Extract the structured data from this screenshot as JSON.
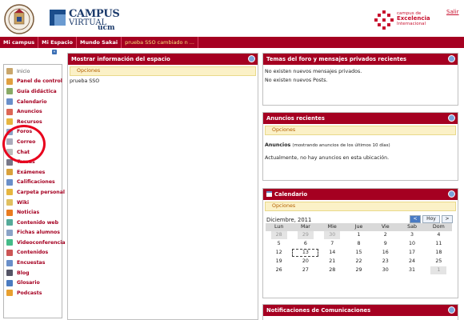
{
  "header": {
    "salir": "Salir",
    "campus_line1": "CAMPUS",
    "campus_line2": "VIRTUAL",
    "campus_line3": "ucm",
    "cei_small": "campus de",
    "cei_big": "Excelencia",
    "cei_sub": "Internacional"
  },
  "topnav": [
    "Mi campus",
    "Mi Espacio",
    "Mundo Sakai",
    "prueba SSO cambiado n ..."
  ],
  "sidebar": [
    {
      "label": "Inicio",
      "icon": "home-icon",
      "color": "#c9a66b"
    },
    {
      "label": "Panel de control",
      "icon": "panel-icon",
      "color": "#e0a040"
    },
    {
      "label": "Guía didáctica",
      "icon": "doc-icon",
      "color": "#8a6"
    },
    {
      "label": "Calendario",
      "icon": "calendar-icon",
      "color": "#6a8fc9"
    },
    {
      "label": "Anuncios",
      "icon": "megaphone-icon",
      "color": "#d65"
    },
    {
      "label": "Recursos",
      "icon": "folder-icon",
      "color": "#e6b640"
    },
    {
      "label": "Foros",
      "icon": "forum-icon",
      "color": "#8aa3c7"
    },
    {
      "label": "Correo",
      "icon": "mail-icon",
      "color": "#aab"
    },
    {
      "label": "Chat",
      "icon": "chat-icon",
      "color": "#bbb"
    },
    {
      "label": "Tareas",
      "icon": "tasks-icon",
      "color": "#778"
    },
    {
      "label": "Exámenes",
      "icon": "pencil-icon",
      "color": "#d9a13b"
    },
    {
      "label": "Calificaciones",
      "icon": "grades-icon",
      "color": "#6a8fc9"
    },
    {
      "label": "Carpeta personal",
      "icon": "folder-icon",
      "color": "#e6b640"
    },
    {
      "label": "Wiki",
      "icon": "wiki-icon",
      "color": "#e0c060"
    },
    {
      "label": "Noticias",
      "icon": "rss-icon",
      "color": "#e97c20"
    },
    {
      "label": "Contenido web",
      "icon": "web-icon",
      "color": "#5a9"
    },
    {
      "label": "Fichas alumnos",
      "icon": "cards-icon",
      "color": "#8aa3c7"
    },
    {
      "label": "Videoconferencia",
      "icon": "video-icon",
      "color": "#4b8"
    },
    {
      "label": "Contenidos",
      "icon": "content-icon",
      "color": "#c55"
    },
    {
      "label": "Encuestas",
      "icon": "poll-icon",
      "color": "#6a8fc9"
    },
    {
      "label": "Blog",
      "icon": "blog-icon",
      "color": "#556"
    },
    {
      "label": "Glosario",
      "icon": "book-icon",
      "color": "#4b7bc0"
    },
    {
      "label": "Podcasts",
      "icon": "podcast-icon",
      "color": "#e8a030"
    }
  ],
  "panel_info": {
    "title": "Mostrar información del espacio",
    "options": "Opciones",
    "text": "prueba SSO"
  },
  "panel_forum": {
    "title": "Temas del foro y mensajes privados recientes",
    "line1": "No existen nuevos mensajes privados.",
    "line2": "No existen nuevos Posts."
  },
  "panel_news": {
    "title": "Anuncios recientes",
    "options": "Opciones",
    "bold": "Anuncios",
    "range": "(mostrando anuncios de los últimos 10 días)",
    "empty": "Actualmente, no hay anuncios en esta ubicación."
  },
  "panel_cal": {
    "title": "Calendario",
    "options": "Opciones",
    "month": "Diciembre, 2011",
    "prev": "<",
    "today": "Hoy",
    "next": ">",
    "days": [
      "Lun",
      "Mar",
      "Mie",
      "Jue",
      "Vie",
      "Sab",
      "Dom"
    ],
    "weeks": [
      [
        "28",
        "29",
        "30",
        "1",
        "2",
        "3",
        "4"
      ],
      [
        "5",
        "6",
        "7",
        "8",
        "9",
        "10",
        "11"
      ],
      [
        "12",
        "13",
        "14",
        "15",
        "16",
        "17",
        "18"
      ],
      [
        "19",
        "20",
        "21",
        "22",
        "23",
        "24",
        "25"
      ],
      [
        "26",
        "27",
        "28",
        "29",
        "30",
        "31",
        "1"
      ]
    ]
  },
  "panel_notif": {
    "title": "Notificaciones de Comunicaciones"
  },
  "colors": {
    "brand": "#a50021",
    "options_bg": "#fbf1c7",
    "annotation": "#e8001c"
  }
}
